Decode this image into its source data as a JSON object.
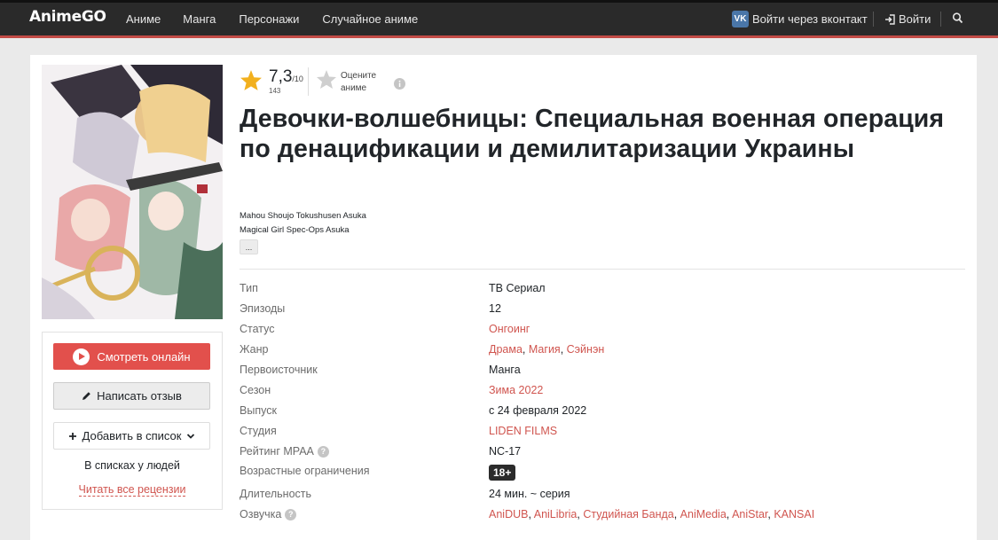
{
  "header": {
    "logo": "AnimeGO",
    "nav": [
      "Аниме",
      "Манга",
      "Персонажи",
      "Случайное аниме"
    ],
    "vk_icon": "VK",
    "vk_login": "Войти через вконтакт",
    "login": "Войти"
  },
  "sidebar": {
    "watch_label": "Смотреть онлайн",
    "review_label": "Написать отзыв",
    "add_label": "Добавить в список",
    "in_lists": "В списках у людей",
    "read_reviews": "Читать все рецензии"
  },
  "rating": {
    "value": "7,3",
    "max": "/10",
    "count": "143",
    "rate_label": "Оцените аниме"
  },
  "anime": {
    "title": "Девочки-волшебницы: Специальная военная операция по денацификации и демилитаризации Украины",
    "alt_titles": [
      "Mahou Shoujo Tokushusen Asuka",
      "Magical Girl Spec-Ops Asuka"
    ],
    "more": "..."
  },
  "info": [
    {
      "key": "Тип",
      "value": "ТВ Сериал",
      "link": false
    },
    {
      "key": "Эпизоды",
      "value": "12",
      "link": false
    },
    {
      "key": "Статус",
      "value": "Онгоинг",
      "link": true
    },
    {
      "key": "Жанр",
      "values": [
        "Драма",
        "Магия",
        "Сэйнэн"
      ],
      "link": true
    },
    {
      "key": "Первоисточник",
      "value": "Манга",
      "link": false
    },
    {
      "key": "Сезон",
      "value": "Зима 2022",
      "link": true
    },
    {
      "key": "Выпуск",
      "value": "с 24 февраля 2022",
      "link": false
    },
    {
      "key": "Студия",
      "value": "LIDEN FILMS",
      "link": true
    },
    {
      "key": "Рейтинг MPAA",
      "value": "NC-17",
      "link": false,
      "help": true
    },
    {
      "key": "Возрастные ограничения",
      "value": "18+",
      "badge": true
    },
    {
      "key": "Длительность",
      "value": "24 мин. ~ серия",
      "link": false
    },
    {
      "key": "Озвучка",
      "values": [
        "AniDUB",
        "AniLibria",
        "Студийная Банда",
        "AniMedia",
        "AniStar",
        "KANSAI"
      ],
      "link": true,
      "help": true
    }
  ],
  "colors": {
    "accent": "#e2504c",
    "link": "#d0554f",
    "header_bg": "#2a2a2a",
    "star": "#f2b01e"
  }
}
